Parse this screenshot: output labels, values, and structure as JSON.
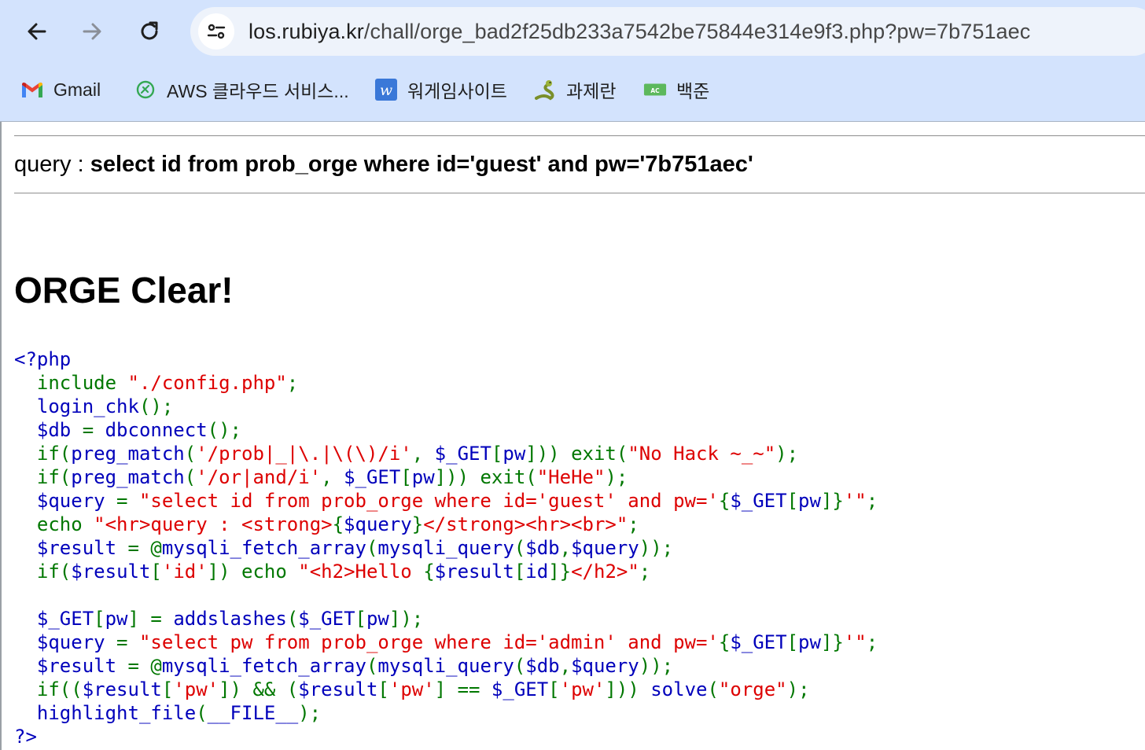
{
  "browser": {
    "url_host": "los.rubiya.kr",
    "url_path": "/chall/orge_bad2f25db233a7542be75844e314e9f3.php?pw=7b751aec",
    "bookmarks": [
      {
        "label": "Gmail",
        "icon": "gmail-icon"
      },
      {
        "label": "AWS 클라우드 서비스...",
        "icon": "aws-icon"
      },
      {
        "label": "워게임사이트",
        "icon": "wargame-icon"
      },
      {
        "label": "과제란",
        "icon": "snake-icon"
      },
      {
        "label": "백준",
        "icon": "baekjoon-icon"
      }
    ]
  },
  "page": {
    "query_label": "query : ",
    "query_text": "select id from prob_orge where id='guest' and pw='7b751aec'",
    "clear_title": "ORGE Clear!"
  },
  "code_lines": [
    [
      {
        "t": "<?php",
        "c": "d"
      }
    ],
    [
      {
        "t": "  ",
        "c": "d"
      },
      {
        "t": "include ",
        "c": "k"
      },
      {
        "t": "\"./config.php\"",
        "c": "s"
      },
      {
        "t": ";",
        "c": "k"
      }
    ],
    [
      {
        "t": "  login_chk",
        "c": "d"
      },
      {
        "t": "();",
        "c": "k"
      }
    ],
    [
      {
        "t": "  $db ",
        "c": "d"
      },
      {
        "t": "= ",
        "c": "k"
      },
      {
        "t": "dbconnect",
        "c": "d"
      },
      {
        "t": "();",
        "c": "k"
      }
    ],
    [
      {
        "t": "  ",
        "c": "d"
      },
      {
        "t": "if(",
        "c": "k"
      },
      {
        "t": "preg_match",
        "c": "d"
      },
      {
        "t": "(",
        "c": "k"
      },
      {
        "t": "'/prob|_|\\.|\\(\\)/i'",
        "c": "s"
      },
      {
        "t": ", ",
        "c": "k"
      },
      {
        "t": "$_GET",
        "c": "d"
      },
      {
        "t": "[",
        "c": "k"
      },
      {
        "t": "pw",
        "c": "d"
      },
      {
        "t": "])) exit(",
        "c": "k"
      },
      {
        "t": "\"No Hack ~_~\"",
        "c": "s"
      },
      {
        "t": ");",
        "c": "k"
      }
    ],
    [
      {
        "t": "  ",
        "c": "d"
      },
      {
        "t": "if(",
        "c": "k"
      },
      {
        "t": "preg_match",
        "c": "d"
      },
      {
        "t": "(",
        "c": "k"
      },
      {
        "t": "'/or|and/i'",
        "c": "s"
      },
      {
        "t": ", ",
        "c": "k"
      },
      {
        "t": "$_GET",
        "c": "d"
      },
      {
        "t": "[",
        "c": "k"
      },
      {
        "t": "pw",
        "c": "d"
      },
      {
        "t": "])) exit(",
        "c": "k"
      },
      {
        "t": "\"HeHe\"",
        "c": "s"
      },
      {
        "t": ");",
        "c": "k"
      }
    ],
    [
      {
        "t": "  $query ",
        "c": "d"
      },
      {
        "t": "= ",
        "c": "k"
      },
      {
        "t": "\"select id from prob_orge where id='guest' and pw='",
        "c": "s"
      },
      {
        "t": "{",
        "c": "k"
      },
      {
        "t": "$_GET",
        "c": "d"
      },
      {
        "t": "[",
        "c": "k"
      },
      {
        "t": "pw",
        "c": "d"
      },
      {
        "t": "]}",
        "c": "k"
      },
      {
        "t": "'\"",
        "c": "s"
      },
      {
        "t": ";",
        "c": "k"
      }
    ],
    [
      {
        "t": "  ",
        "c": "d"
      },
      {
        "t": "echo ",
        "c": "k"
      },
      {
        "t": "\"<hr>query : <strong>",
        "c": "s"
      },
      {
        "t": "{",
        "c": "k"
      },
      {
        "t": "$query",
        "c": "d"
      },
      {
        "t": "}",
        "c": "k"
      },
      {
        "t": "</strong><hr><br>\"",
        "c": "s"
      },
      {
        "t": ";",
        "c": "k"
      }
    ],
    [
      {
        "t": "  $result ",
        "c": "d"
      },
      {
        "t": "= @",
        "c": "k"
      },
      {
        "t": "mysqli_fetch_array",
        "c": "d"
      },
      {
        "t": "(",
        "c": "k"
      },
      {
        "t": "mysqli_query",
        "c": "d"
      },
      {
        "t": "(",
        "c": "k"
      },
      {
        "t": "$db",
        "c": "d"
      },
      {
        "t": ",",
        "c": "k"
      },
      {
        "t": "$query",
        "c": "d"
      },
      {
        "t": "));",
        "c": "k"
      }
    ],
    [
      {
        "t": "  ",
        "c": "d"
      },
      {
        "t": "if(",
        "c": "k"
      },
      {
        "t": "$result",
        "c": "d"
      },
      {
        "t": "[",
        "c": "k"
      },
      {
        "t": "'id'",
        "c": "s"
      },
      {
        "t": "]) echo ",
        "c": "k"
      },
      {
        "t": "\"<h2>Hello ",
        "c": "s"
      },
      {
        "t": "{",
        "c": "k"
      },
      {
        "t": "$result",
        "c": "d"
      },
      {
        "t": "[",
        "c": "k"
      },
      {
        "t": "id",
        "c": "d"
      },
      {
        "t": "]}",
        "c": "k"
      },
      {
        "t": "</h2>\"",
        "c": "s"
      },
      {
        "t": ";",
        "c": "k"
      }
    ],
    [
      {
        "t": " ",
        "c": "d"
      }
    ],
    [
      {
        "t": "  $_GET",
        "c": "d"
      },
      {
        "t": "[",
        "c": "k"
      },
      {
        "t": "pw",
        "c": "d"
      },
      {
        "t": "] = ",
        "c": "k"
      },
      {
        "t": "addslashes",
        "c": "d"
      },
      {
        "t": "(",
        "c": "k"
      },
      {
        "t": "$_GET",
        "c": "d"
      },
      {
        "t": "[",
        "c": "k"
      },
      {
        "t": "pw",
        "c": "d"
      },
      {
        "t": "]);",
        "c": "k"
      }
    ],
    [
      {
        "t": "  $query ",
        "c": "d"
      },
      {
        "t": "= ",
        "c": "k"
      },
      {
        "t": "\"select pw from prob_orge where id='admin' and pw='",
        "c": "s"
      },
      {
        "t": "{",
        "c": "k"
      },
      {
        "t": "$_GET",
        "c": "d"
      },
      {
        "t": "[",
        "c": "k"
      },
      {
        "t": "pw",
        "c": "d"
      },
      {
        "t": "]}",
        "c": "k"
      },
      {
        "t": "'\"",
        "c": "s"
      },
      {
        "t": ";",
        "c": "k"
      }
    ],
    [
      {
        "t": "  $result ",
        "c": "d"
      },
      {
        "t": "= @",
        "c": "k"
      },
      {
        "t": "mysqli_fetch_array",
        "c": "d"
      },
      {
        "t": "(",
        "c": "k"
      },
      {
        "t": "mysqli_query",
        "c": "d"
      },
      {
        "t": "(",
        "c": "k"
      },
      {
        "t": "$db",
        "c": "d"
      },
      {
        "t": ",",
        "c": "k"
      },
      {
        "t": "$query",
        "c": "d"
      },
      {
        "t": "));",
        "c": "k"
      }
    ],
    [
      {
        "t": "  ",
        "c": "d"
      },
      {
        "t": "if((",
        "c": "k"
      },
      {
        "t": "$result",
        "c": "d"
      },
      {
        "t": "[",
        "c": "k"
      },
      {
        "t": "'pw'",
        "c": "s"
      },
      {
        "t": "]) && (",
        "c": "k"
      },
      {
        "t": "$result",
        "c": "d"
      },
      {
        "t": "[",
        "c": "k"
      },
      {
        "t": "'pw'",
        "c": "s"
      },
      {
        "t": "] == ",
        "c": "k"
      },
      {
        "t": "$_GET",
        "c": "d"
      },
      {
        "t": "[",
        "c": "k"
      },
      {
        "t": "'pw'",
        "c": "s"
      },
      {
        "t": "])) ",
        "c": "k"
      },
      {
        "t": "solve",
        "c": "d"
      },
      {
        "t": "(",
        "c": "k"
      },
      {
        "t": "\"orge\"",
        "c": "s"
      },
      {
        "t": ");",
        "c": "k"
      }
    ],
    [
      {
        "t": "  highlight_file",
        "c": "d"
      },
      {
        "t": "(",
        "c": "k"
      },
      {
        "t": "__FILE__",
        "c": "d"
      },
      {
        "t": ");",
        "c": "k"
      }
    ],
    [
      {
        "t": "?>",
        "c": "d"
      }
    ]
  ],
  "colors": {
    "toolbar_bg": "#d3e3fd",
    "omnibox_bg": "#eef3fb",
    "php_default": "#0000bb",
    "php_keyword": "#007700",
    "php_string": "#dd0000"
  }
}
